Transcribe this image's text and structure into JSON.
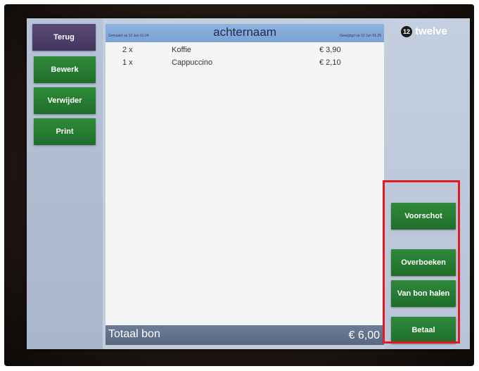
{
  "sidebar": {
    "back_label": "Terug",
    "edit_label": "Bewerk",
    "delete_label": "Verwijder",
    "print_label": "Print"
  },
  "receipt": {
    "title": "achternaam",
    "created_text": "Gemaakt op 12 Jun 01:24",
    "modified_text": "Gewijzigd op 12 Jun 01:25",
    "items": [
      {
        "qty": "2 x",
        "name": "Koffie",
        "price": "€ 3,90"
      },
      {
        "qty": "1 x",
        "name": "Cappuccino",
        "price": "€ 2,10"
      }
    ],
    "total_label": "Totaal bon",
    "total_value": "€ 6,00"
  },
  "brand": {
    "name": "twelve",
    "icon": "twelve-logo-icon"
  },
  "actions": {
    "advance_label": "Voorschot",
    "transfer_label": "Overboeken",
    "from_bill_label": "Van bon halen",
    "pay_label": "Betaal"
  },
  "colors": {
    "green_button": "#2f8a3a",
    "purple_button": "#5a4a78",
    "highlight": "#e01b24"
  }
}
